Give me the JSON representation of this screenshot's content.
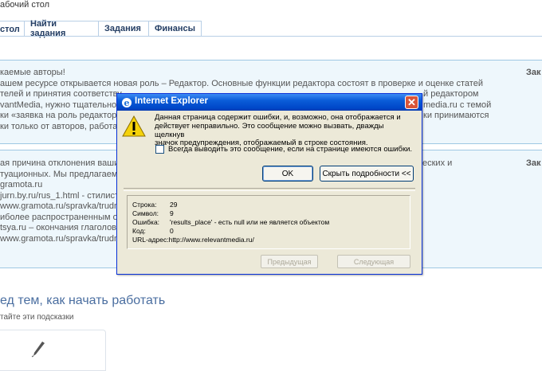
{
  "top": {
    "breadcrumb": "абочий стол"
  },
  "tabs": [
    {
      "label": "стол"
    },
    {
      "label": "Найти задания"
    },
    {
      "label": "Задания"
    },
    {
      "label": "Финансы"
    }
  ],
  "panel1": {
    "lines": [
      "каемые авторы!",
      "ашем ресурсе открывается новая роль – Редактор. Основные функции редактора состоят в проверке и оценке статей",
      "телей и принятия соответству",
      "vantMedia, нужно тщательно и",
      "ки «заявка на роль редактора",
      "ки только от авторов, работаю"
    ],
    "right_fragments": [
      "й редактором",
      "media.ru с темой",
      "ки принимаются"
    ],
    "more": "Зак"
  },
  "panel2": {
    "lines": [
      "ая причина отклонения ваших",
      "туационных. Мы предлагаем в",
      "gramota.ru",
      "jurn.by.ru/rus_1.html - стилист",
      "www.gramota.ru/spravka/trudno",
      "иболее распространенным ош",
      "tsya.ru – окончания глаголов",
      "www.gramota.ru/spravka/trudno"
    ],
    "right_fragment": "еских и",
    "more": "Зак"
  },
  "heading": "ед тем, как начать работать",
  "subheading": "тайте эти подсказки",
  "dialog": {
    "title": "Internet Explorer",
    "close": "✕",
    "message": [
      "Данная страница содержит ошибки, и, возможно, она отображается и",
      "действует неправильно. Это сообщение можно вызвать, дважды щелкнув",
      "значок предупреждения, отображаемый в строке состояния."
    ],
    "checkbox_label": "Всегда выводить это сообщение, если на странице имеются ошибки.",
    "ok": "OK",
    "details_button": "Скрыть подробности <<",
    "details": [
      {
        "label": "Строка:",
        "value": "29"
      },
      {
        "label": "Символ:",
        "value": "9"
      },
      {
        "label": "Ошибка:",
        "value": "'results_place' -  есть null или не является объектом"
      },
      {
        "label": "Код:",
        "value": "0"
      },
      {
        "label": "URL-адрес:",
        "value": "http://www.relevantmedia.ru/"
      }
    ],
    "prev": "Предыдущая",
    "next": "Следующая"
  },
  "colors": {
    "titlebar": "#0a5cd8",
    "panel_bg": "#eef7fc",
    "panel_border": "#9fc8e3",
    "heading": "#4a6ea0"
  },
  "icons": {
    "window": "ie-icon",
    "warning": "warning-icon",
    "pen": "pen-icon"
  }
}
